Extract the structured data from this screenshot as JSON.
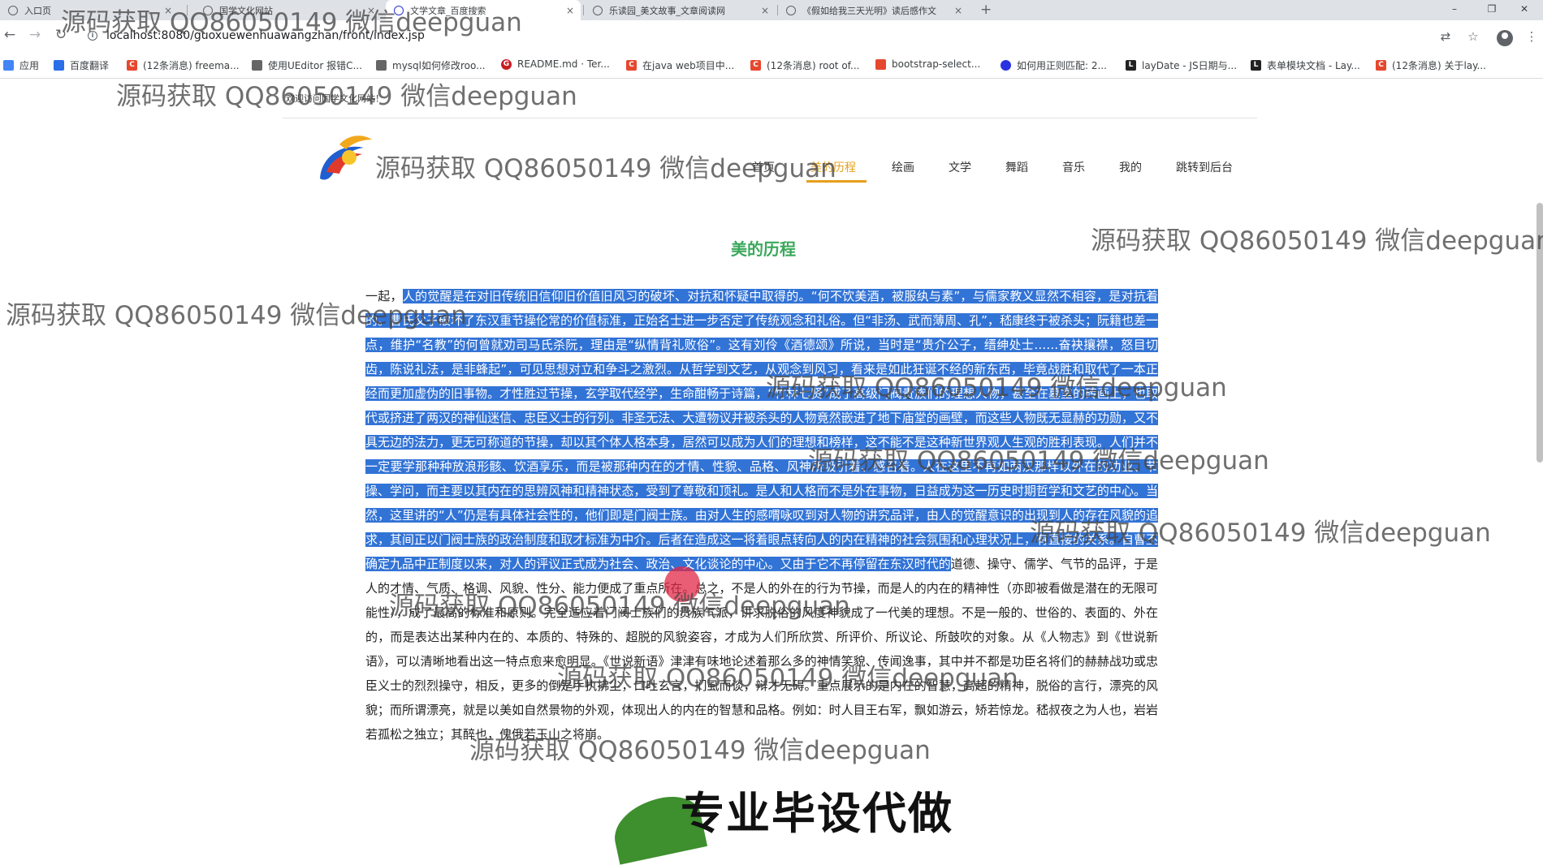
{
  "browser": {
    "tabs": [
      {
        "label": "入口页",
        "active": false
      },
      {
        "label": "国学文化网站",
        "active": false
      },
      {
        "label": "文学文章_百度搜索",
        "active": true
      },
      {
        "label": "乐读园_美文故事_文章阅读网",
        "active": false
      },
      {
        "label": "《假如给我三天光明》读后感作文",
        "active": false
      }
    ],
    "tab_close": "×",
    "new_tab": "+",
    "window_controls": {
      "minimize": "–",
      "restore": "❐",
      "close": "✕"
    },
    "url": "localhost:8080/guoxuewenhuawangzhan/front/index.jsp",
    "bookmarks": [
      {
        "label": "应用",
        "icon": "apps-icon",
        "color": "#4285f4"
      },
      {
        "label": "百度翻译",
        "icon": "baidu-translate-icon",
        "color": "#2a6ee8"
      },
      {
        "label": "(12条消息) freema...",
        "icon": "csdn-icon",
        "color": "#e5482e"
      },
      {
        "label": "使用UEditor 报错C...",
        "icon": "ueditor-icon",
        "color": "#666666"
      },
      {
        "label": "mysql如何修改roo...",
        "icon": "bookmark-icon",
        "color": "#666666"
      },
      {
        "label": "README.md · Ter...",
        "icon": "gitee-icon",
        "color": "#c71d23"
      },
      {
        "label": "在java web项目中...",
        "icon": "csdn-icon",
        "color": "#e5482e"
      },
      {
        "label": "(12条消息) root of...",
        "icon": "csdn-icon",
        "color": "#e5482e"
      },
      {
        "label": "bootstrap-select...",
        "icon": "bootstrap-icon",
        "color": "#e5482e"
      },
      {
        "label": "如何用正则匹配: 2...",
        "icon": "baidu-icon",
        "color": "#2932e1"
      },
      {
        "label": "layDate - JS日期与...",
        "icon": "layui-icon",
        "color": "#222222"
      },
      {
        "label": "表单模块文档 - Lay...",
        "icon": "layui-icon",
        "color": "#222222"
      },
      {
        "label": "(12条消息) 关于lay...",
        "icon": "csdn-icon",
        "color": "#e5482e"
      }
    ]
  },
  "page": {
    "welcome": "欢迎访问国学文化网站！",
    "nav": [
      {
        "label": "首页",
        "active": false
      },
      {
        "label": "美的历程",
        "active": true
      },
      {
        "label": "绘画",
        "active": false
      },
      {
        "label": "文学",
        "active": false
      },
      {
        "label": "舞蹈",
        "active": false
      },
      {
        "label": "音乐",
        "active": false
      },
      {
        "label": "我的",
        "active": false
      },
      {
        "label": "跳转到后台",
        "active": false
      }
    ],
    "article_title": "美的历程",
    "article_lead": "一起，",
    "article_selected": "人的觉醒是在对旧传统旧信仰旧价值旧风习的破坏、对抗和怀疑中取得的。“何不饮美酒，被服纨与素”，与儒家教义显然不相容，是对抗着的。曹氏父子破坏了东汉重节操伦常的价值标准，正始名士进一步否定了传统观念和礼俗。但“非汤、武而薄周、孔”，嵇康终于被杀头；阮籍也差一点，维护“名教”的何曾就劝司马氏杀阮，理由是“纵情背礼败俗”。这有刘伶《酒德颂》所说，当时是“贵介公子，缙绅处士……奋袂攘襟，怒目切齿，陈说礼法，是非蜂起”，可见思想对立和争斗之激烈。从哲学到文艺，从观念到风习，看来是如此狂诞不经的新东西，毕竟战胜和取代了一本正经而更加虚伪的旧事物。才性胜过节操，玄学取代经学，生命酣畅于诗篇，“竹林七贤”成了高级门阀贵族们的理想人物，甚至在墓室的砖画上，也取代或挤进了两汉的神仙迷信、忠臣义士的行列。非圣无法、大遭物议并被杀头的人物竟然嵌进了地下庙堂的画壁，而这些人物既无显赫的功勋，又不具无边的法力，更无可称道的节操，却以其个体人格本身，居然可以成为人们的理想和榜样，这不能不是这种新世界观人生观的胜利表现。人们并不一定要学那种种放浪形骸、饮酒享乐，而是被那种内在的才情、性貌、品格、风神所吸引着、感召着。人在这里不再如两汉那样以外在的功业、节操、学问，而主要以其内在的思辨风神和精神状态，受到了尊敬和顶礼。是人和人格而不是外在事物，日益成为这一历史时期哲学和文艺的中心。当然，这里讲的“人”仍是有具体社会性的，他们即是门阀士族。由对人生的感喟咏叹到对人物的讲究品评，由人的觉醒意识的出现到人的存在风貌的追求，其间正以门阀士族的政治制度和取才标准为中介。后者在造成这一将着眼点转向人的内在精神的社会氛围和心理状况上，有直接的关系。自曹丕确定九品中正制度以来，对人的评议正式成为社会、政治、文化谈论的中心。又由于它不再停留在东汉时代的",
    "article_rest": "道德、操守、儒学、气节的品评，于是人的才情、气质、格调、风貌、性分、能力便成了重点所在。总之，不是人的外在的行为节操，而是人的内在的精神性（亦即被看做是潜在的无限可能性），成了最高的标准和原则。完全适应着门阀士族们的贵族气派，讲求脱俗的风度神貌成了一代美的理想。不是一般的、世俗的、表面的、外在的，而是表达出某种内在的、本质的、特殊的、超脱的风貌姿容，才成为人们所欣赏、所评价、所议论、所鼓吹的对象。从《人物志》到《世说新语》，可以清晰地看出这一特点愈来愈明显。《世说新语》津津有味地论述着那么多的神情笑貌、传闻逸事，其中并不都是功臣名将们的赫赫战功或忠臣义士的烈烈操守，相反，更多的倒是手执拂尘，口吐玄言，扪虱而谈，辩才无碍。重点展示的是内在的智慧，高超的精神，脱俗的言行，漂亮的风貌；而所谓漂亮，就是以美如自然景物的外观，体现出人的内在的智慧和品格。例如：时人目王右军，飘如游云，矫若惊龙。嵇叔夜之为人也，岩岩若孤松之独立；其醉也，傀俄若玉山之将崩。",
    "promo": "专业毕设代做"
  },
  "watermark": "源码获取 QQ86050149 微信deepguan",
  "colors": {
    "accent": "#e6a01c",
    "title_green": "#3aa85b",
    "selection": "#3273d6"
  }
}
